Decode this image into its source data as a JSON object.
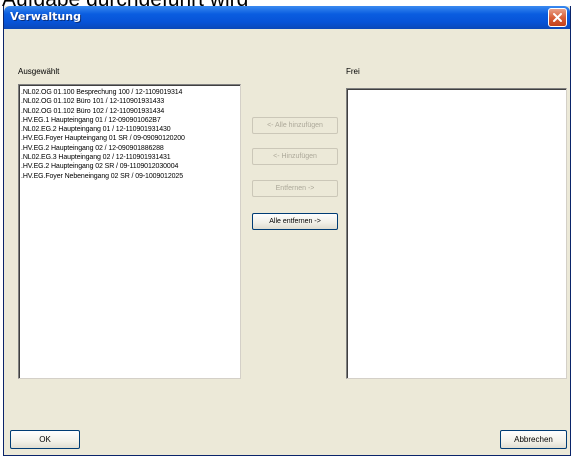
{
  "background_text": "Aufgabe durchgeführt wird",
  "window": {
    "title": "Verwaltung",
    "close_icon": "close-icon"
  },
  "selected_panel": {
    "label": "Ausgewählt",
    "items": [
      ".NL02.OG 01.100 Besprechung 100 / 12-1109019314",
      ".NL02.OG 01.102 Büro 101 / 12-110901931433",
      ".NL02.OG 01.102 Büro 102 / 12-110901931434",
      ".HV.EG.1 Haupteingang 01 / 12-090901062B7",
      ".NL02.EG.2 Haupteingang 01 / 12-110901931430",
      ".HV.EG.Foyer Haupteingang 01 SR / 09-09090120200",
      ".HV.EG.2 Haupteingang 02 / 12-090901886288",
      ".NL02.EG.3 Haupteingang 02 / 12-110901931431",
      ".HV.EG.2 Haupteingang 02 SR / 09-1109012030004",
      ".HV.EG.Foyer Nebeneingang 02 SR / 09-1009012025"
    ]
  },
  "free_panel": {
    "label": "Frei",
    "items": []
  },
  "buttons": {
    "add_all": "<- Alle hinzufügen",
    "add": "<- Hinzufügen",
    "remove": "Entfernen ->",
    "remove_all": "Alle entfernen ->",
    "ok": "OK",
    "cancel": "Abbrechen"
  },
  "colors": {
    "titlebar": "#0753d8",
    "dialog_bg": "#ece9d8",
    "close_button": "#d8603a"
  }
}
